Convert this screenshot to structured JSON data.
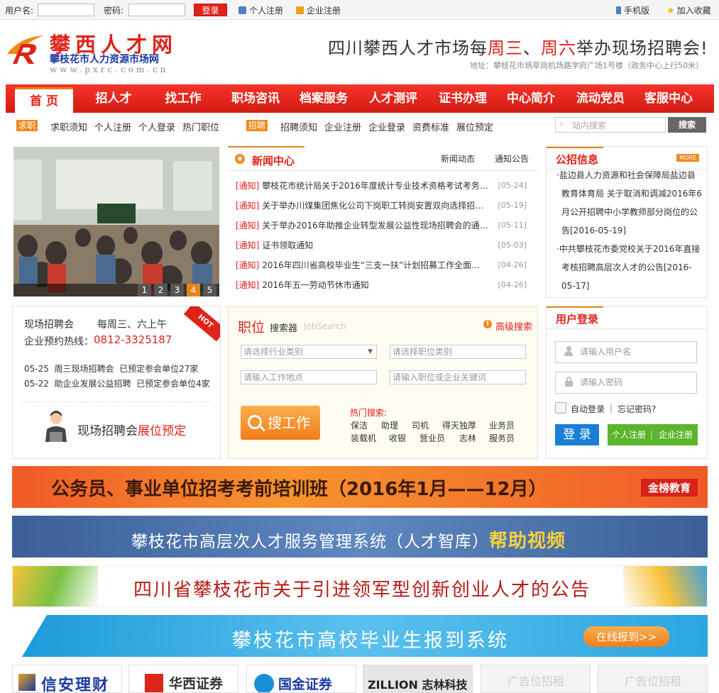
{
  "topbar": {
    "username_label": "用户名:",
    "password_label": "密码:",
    "login_button": "登录",
    "personal_register": "个人注册",
    "company_register": "企业注册",
    "mobile": "手机版",
    "favorite": "加入收藏"
  },
  "header": {
    "logo_title": "攀西人才网",
    "logo_subtitle": "攀枝花市人力资源市场网",
    "logo_url": "www.pxrc.com.cn",
    "slogan_part1": "四川攀西人才市场每",
    "slogan_hl1": "周三",
    "slogan_part2": "、",
    "slogan_hl2": "周六",
    "slogan_part3": "举办现场招聘会!",
    "address": "地址：攀枝花市炳草岗机场路学府广场1号楼（政务中心上行50米）"
  },
  "nav": [
    "首 页",
    "招人才",
    "找工作",
    "职场咨讯",
    "档案服务",
    "人才测评",
    "证书办理",
    "中心简介",
    "流动党员",
    "客服中心"
  ],
  "subnav": {
    "seek_tag": "求职",
    "seek_links": [
      "求职须知",
      "个人注册",
      "个人登录",
      "热门职位"
    ],
    "recruit_tag": "招聘",
    "recruit_links": [
      "招聘须知",
      "企业注册",
      "企业登录",
      "资费标准",
      "展位预定"
    ],
    "search_placeholder": "站内搜索",
    "search_button": "搜索"
  },
  "slideshow": {
    "pages": [
      "1",
      "2",
      "3",
      "4",
      "5"
    ],
    "active": 4
  },
  "news": {
    "title": "新闻中心",
    "tabs": [
      "新闻动态",
      "通知公告"
    ],
    "items": [
      {
        "tag": "[通知]",
        "title": "攀枝花市统计局关于2016年度统计专业技术资格考试考务…",
        "date": "[05-24]"
      },
      {
        "tag": "[通知]",
        "title": "关于举办川煤集团焦化公司下岗职工转岗安置双向选择招…",
        "date": "[05-19]"
      },
      {
        "tag": "[通知]",
        "title": "关于举办2016年助推企业转型发展公益性现场招聘会的通…",
        "date": "[05-11]"
      },
      {
        "tag": "[通知]",
        "title": "证书领取通知",
        "date": "[05-03]"
      },
      {
        "tag": "[通知]",
        "title": "2016年四川省高校毕业生“三支一扶”计划招募工作全面…",
        "date": "[04-26]"
      },
      {
        "tag": "[通知]",
        "title": "2016年五一劳动节休市通知",
        "date": "[04-26]"
      }
    ]
  },
  "gov": {
    "title": "公招信息",
    "more": "MORE",
    "lines1": [
      "·盐边县人力资源和社会保障局盐边县",
      "教育体育局 关于取消和调减2016年6",
      "月公开招聘中小学教师部分岗位的公",
      "告[2016-05-19]"
    ],
    "lines2": [
      "·中共攀枝花市委党校关于2016年直接",
      "考核招聘高层次人才的公告[2016-",
      "05-17]"
    ]
  },
  "jobfair": {
    "label": "现场招聘会",
    "schedule": "每周三、六上午",
    "hotline_label": "企业预约热线：",
    "hotline": "0812-3325187",
    "hot_badge": "HOT",
    "rows": [
      {
        "date": "05-25",
        "name": "周三现场招聘会",
        "status": "已预定参会单位27家"
      },
      {
        "date": "05-22",
        "name": "助企业发展公益招聘",
        "status": "已预定参会单位4家"
      }
    ],
    "booking_text1": "现场招聘会",
    "booking_text2": "展位预定"
  },
  "jobsearch": {
    "title_big": "职位",
    "title_small": "搜索器",
    "title_en": "JobSearch",
    "advanced": "高级搜索",
    "industry_placeholder": "请选择行业类别",
    "position_placeholder": "请选择职位类别",
    "location_placeholder": "请输入工作地点",
    "keyword_placeholder": "请输入职位或企业关键词",
    "search_button": "搜工作",
    "hot_label": "热门搜索:",
    "hot_row1": [
      "保洁",
      "助理",
      "司机",
      "得天独厚",
      "业务员"
    ],
    "hot_row2": [
      "装载机",
      "收银",
      "营业员",
      "志林",
      "服务员"
    ]
  },
  "login": {
    "title": "用户登录",
    "username_placeholder": "请输入用户名",
    "password_placeholder": "请输入密码",
    "auto_login": "自动登录",
    "separator": "|",
    "forgot": "忘记密码?",
    "login_button": "登 录",
    "personal_register": "个人注册",
    "company_register": "企业注册"
  },
  "banners": {
    "b1_text": "公务员、事业单位招考考前培训班（2016年1月——12月）",
    "b1_badge": "金榜教育",
    "b2_text1": "攀枝花市高层次人才服务管理系统（人才智库）",
    "b2_text2": "帮助视频",
    "b3_text": "四川省攀枝花市关于引进领军型创新创业人才的公告",
    "b4_text": "攀枝花市高校毕业生报到系统",
    "b4_button": "在线报到>>"
  },
  "partners": [
    "信安理财",
    "华西证券",
    "国金证券",
    "ZILLION 志林科技",
    "广告位招租",
    "广告位招租"
  ],
  "colors": {
    "brand_red": "#e0231a",
    "accent_orange": "#e8821c",
    "link_blue": "#1c3aa0"
  }
}
